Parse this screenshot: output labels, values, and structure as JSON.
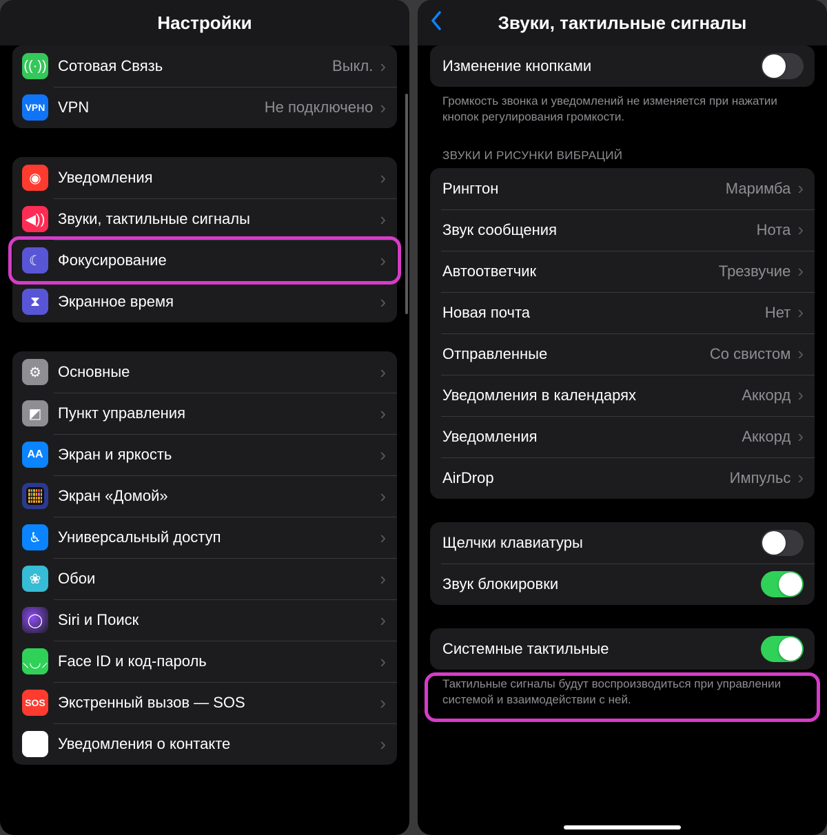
{
  "left": {
    "title": "Настройки",
    "group1": [
      {
        "name": "cellular",
        "label": "Сотовая Связь",
        "value": "Выкл.",
        "iconClass": "i-cellular",
        "iconGlyph": "((·))"
      },
      {
        "name": "vpn",
        "label": "VPN",
        "value": "Не подключено",
        "iconClass": "i-vpn",
        "iconGlyph": "VPN"
      }
    ],
    "group2": [
      {
        "name": "notifications",
        "label": "Уведомления",
        "iconClass": "i-notif",
        "iconGlyph": "◉"
      },
      {
        "name": "sounds",
        "label": "Звуки, тактильные сигналы",
        "iconClass": "i-sounds",
        "iconGlyph": "◀︎))"
      },
      {
        "name": "focus",
        "label": "Фокусирование",
        "iconClass": "i-focus",
        "iconGlyph": "☾"
      },
      {
        "name": "screentime",
        "label": "Экранное время",
        "iconClass": "i-screentime",
        "iconGlyph": "⧗"
      }
    ],
    "group3": [
      {
        "name": "general",
        "label": "Основные",
        "iconClass": "i-general",
        "iconGlyph": "⚙︎"
      },
      {
        "name": "control-center",
        "label": "Пункт управления",
        "iconClass": "i-control",
        "iconGlyph": "◩"
      },
      {
        "name": "display",
        "label": "Экран и яркость",
        "iconClass": "i-display",
        "iconGlyph": "AA"
      },
      {
        "name": "home-screen",
        "label": "Экран «Домой»",
        "iconClass": "i-home",
        "iconGlyph": ""
      },
      {
        "name": "accessibility",
        "label": "Универсальный доступ",
        "iconClass": "i-access",
        "iconGlyph": "♿︎"
      },
      {
        "name": "wallpaper",
        "label": "Обои",
        "iconClass": "i-wallpaper",
        "iconGlyph": "❀"
      },
      {
        "name": "siri",
        "label": "Siri и Поиск",
        "iconClass": "i-siri",
        "iconGlyph": "◯"
      },
      {
        "name": "faceid",
        "label": "Face ID и код-пароль",
        "iconClass": "i-faceid",
        "iconGlyph": "⸜◡⸝"
      },
      {
        "name": "sos",
        "label": "Экстренный вызов — SOS",
        "iconClass": "i-sos",
        "iconGlyph": "SOS"
      },
      {
        "name": "exposure",
        "label": "Уведомления о контакте",
        "iconClass": "i-contact",
        "iconGlyph": "◌"
      }
    ]
  },
  "right": {
    "title": "Звуки, тактильные сигналы",
    "buttonsRow": {
      "label": "Изменение кнопками",
      "on": false
    },
    "buttonsFooter": "Громкость звонка и уведомлений не изменяется при нажатии кнопок регулирования громкости.",
    "soundsHeader": "ЗВУКИ И РИСУНКИ ВИБРАЦИЙ",
    "sounds": [
      {
        "name": "ringtone",
        "label": "Рингтон",
        "value": "Маримба"
      },
      {
        "name": "text-tone",
        "label": "Звук сообщения",
        "value": "Нота"
      },
      {
        "name": "voicemail",
        "label": "Автоответчик",
        "value": "Трезвучие"
      },
      {
        "name": "new-mail",
        "label": "Новая почта",
        "value": "Нет"
      },
      {
        "name": "sent-mail",
        "label": "Отправленные",
        "value": "Со свистом"
      },
      {
        "name": "calendar",
        "label": "Уведомления в календарях",
        "value": "Аккорд"
      },
      {
        "name": "reminders",
        "label": "Уведомления",
        "value": "Аккорд"
      },
      {
        "name": "airdrop",
        "label": "AirDrop",
        "value": "Импульс"
      }
    ],
    "toggles1": [
      {
        "name": "keyboard-clicks",
        "label": "Щелчки клавиатуры",
        "on": false
      },
      {
        "name": "lock-sound",
        "label": "Звук блокировки",
        "on": true
      }
    ],
    "toggles2": [
      {
        "name": "system-haptics",
        "label": "Системные тактильные",
        "on": true
      }
    ],
    "hapticsFooter": "Тактильные сигналы будут воспроизводиться при управлении системой и взаимодействии с ней."
  }
}
